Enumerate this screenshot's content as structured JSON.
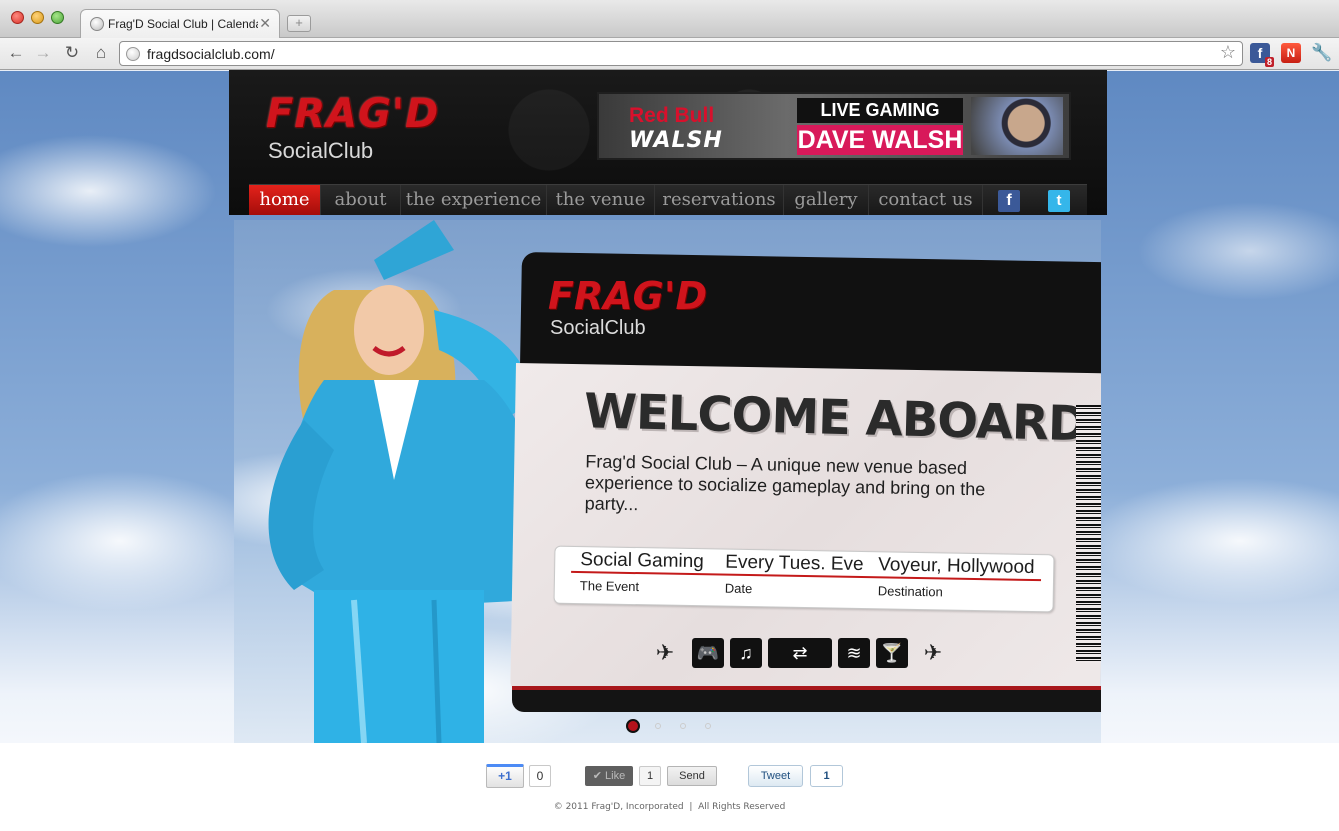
{
  "browser": {
    "tab_title": "Frag'D Social Club | Calendar",
    "tab_close": "✕",
    "new_tab": "+",
    "back": "←",
    "forward": "→",
    "reload": "↻",
    "home": "⌂",
    "url": "fragdsocialclub.com/",
    "bookmark_star": "☆",
    "ext_facebook": "f",
    "ext_facebook_badge": "8",
    "ext_red": "N",
    "wrench": "🔧"
  },
  "header": {
    "logo_fragd": "FRAG'D",
    "logo_social": "SocialClub",
    "banner": {
      "brand": "Red Bull",
      "name": "WALSH",
      "line1": "LIVE GAMING WITH",
      "line2": "DAVE WALSH"
    }
  },
  "nav": {
    "items": [
      {
        "label": "home",
        "active": true
      },
      {
        "label": "about"
      },
      {
        "label": "the experience"
      },
      {
        "label": "the venue"
      },
      {
        "label": "reservations"
      },
      {
        "label": "gallery"
      },
      {
        "label": "contact us"
      }
    ],
    "facebook_icon": "f",
    "twitter_icon": "t"
  },
  "hero": {
    "ticket_logo_fragd": "FRAG'D",
    "ticket_logo_social": "SocialClub",
    "headline": "WELCOME ABOARD,",
    "tagline": "Frag'd Social Club – A unique new venue based experience to socialize gameplay and bring on the party...",
    "event": {
      "value": "Social Gaming",
      "label": "The Event"
    },
    "date": {
      "value": "Every Tues. Eve",
      "label": "Date"
    },
    "destination": {
      "value": "Voyeur, Hollywood",
      "label": "Destination"
    },
    "icons": [
      "wing-icon",
      "gamepad-icon",
      "music-icon",
      "plug-icon",
      "cigar-icon",
      "cocktail-icon",
      "wing-icon"
    ],
    "icon_glyphs": {
      "wing_left": "✈",
      "gamepad": "🎮",
      "music": "♫",
      "plug": "⇄",
      "cigar": "≋",
      "cocktail": "🍸",
      "wing_right": "✈"
    },
    "slide_count": 4,
    "active_slide": 1
  },
  "social": {
    "gplus_label": "+1",
    "gplus_count": "0",
    "fb_like_label": "✔ Like",
    "fb_like_count": "1",
    "fb_send_label": "Send",
    "tweet_label": "Tweet",
    "tweet_count": "1"
  },
  "footer": {
    "copyright": "© 2011 Frag'D, Incorporated  |  All Rights Reserved"
  },
  "colors": {
    "brand_red": "#d0141c",
    "nav_active": "#e3221b",
    "banner_pink": "#d8195a"
  }
}
